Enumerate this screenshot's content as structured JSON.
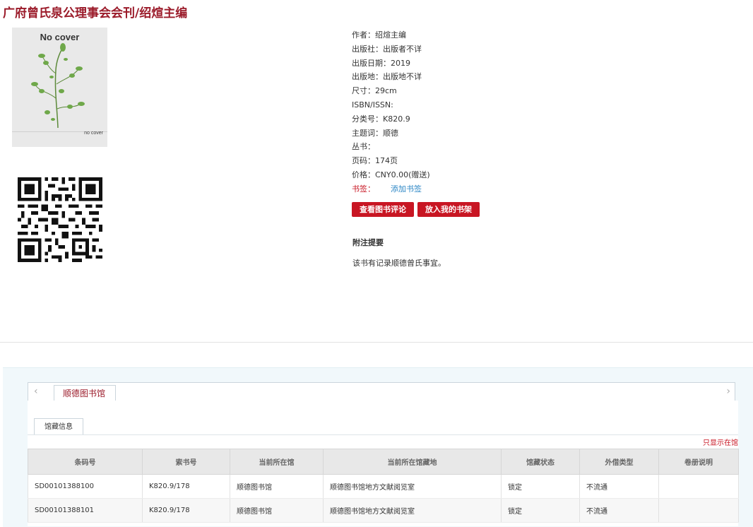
{
  "title": "广府曾氏泉公理事会会刊/绍煊主编",
  "cover": {
    "top_text": "No cover",
    "bottom_text": "no cover"
  },
  "info": [
    {
      "label": "作者：",
      "value": "绍煊主编"
    },
    {
      "label": "出版社：",
      "value": "出版者不详"
    },
    {
      "label": "出版日期：",
      "value": "2019"
    },
    {
      "label": "出版地：",
      "value": "出版地不详"
    },
    {
      "label": "尺寸：",
      "value": "29cm"
    },
    {
      "label": "ISBN/ISSN:",
      "value": ""
    },
    {
      "label": "分类号：",
      "value": "K820.9"
    },
    {
      "label": "主题词：",
      "value": "顺德"
    },
    {
      "label": "丛书：",
      "value": ""
    },
    {
      "label": "页码：",
      "value": "174页"
    },
    {
      "label": "价格：",
      "value": "CNY0.00(赠送)"
    }
  ],
  "bookmark": {
    "label": "书签：",
    "link": "添加书签"
  },
  "buttons": {
    "reviews": "查看图书评论",
    "shelf": "放入我的书架"
  },
  "notes": {
    "heading": "附注提要",
    "text": "该书有记录顺德曾氏事宜。"
  },
  "library_tab": "顺德图书馆",
  "holdings_tab": "馆藏信息",
  "only_available": "只显示在馆",
  "table": {
    "headers": [
      "条码号",
      "索书号",
      "当前所在馆",
      "当前所在馆藏地",
      "馆藏状态",
      "外借类型",
      "卷册说明"
    ],
    "rows": [
      [
        "SD00101388100",
        "K820.9/178",
        "顺德图书馆",
        "顺德图书馆地方文献阅览室",
        "锁定",
        "不流通",
        ""
      ],
      [
        "SD00101388101",
        "K820.9/178",
        "顺德图书馆",
        "顺德图书馆地方文献阅览室",
        "锁定",
        "不流通",
        ""
      ]
    ]
  },
  "icons": {
    "prev": "chevron-left-icon",
    "next": "chevron-right-icon"
  }
}
